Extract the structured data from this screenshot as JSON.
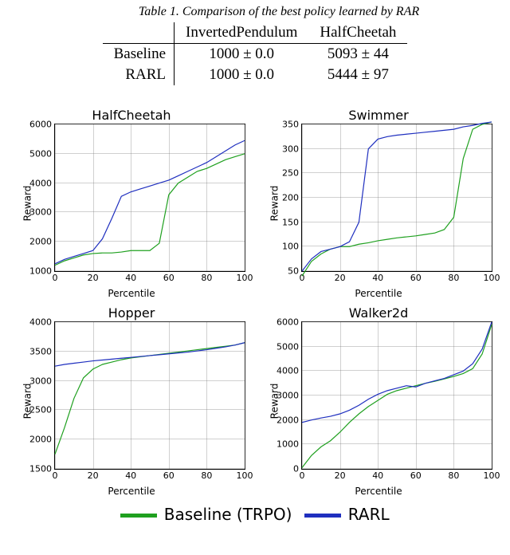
{
  "table": {
    "caption": "Table 1. Comparison of the best policy learned by RAR",
    "columns": [
      "InvertedPendulum",
      "HalfCheetah"
    ],
    "rows": [
      {
        "label": "Baseline",
        "values": [
          "1000 ± 0.0",
          "5093 ± 44"
        ]
      },
      {
        "label": "RARL",
        "values": [
          "1000 ± 0.0",
          "5444 ± 97"
        ]
      }
    ]
  },
  "chart_data": [
    {
      "type": "line",
      "title": "HalfCheetah",
      "xlabel": "Percentile",
      "ylabel": "Reward",
      "xlim": [
        0,
        100
      ],
      "ylim": [
        1000,
        6000
      ],
      "xticks": [
        0,
        20,
        40,
        60,
        80,
        100
      ],
      "yticks": [
        1000,
        2000,
        3000,
        4000,
        5000,
        6000
      ],
      "x": [
        0,
        5,
        10,
        15,
        20,
        25,
        30,
        35,
        40,
        45,
        50,
        55,
        60,
        65,
        70,
        75,
        80,
        85,
        90,
        95,
        100
      ],
      "series": [
        {
          "name": "Baseline (TRPO)",
          "color": "#1fa01f",
          "values": [
            1200,
            1350,
            1450,
            1550,
            1600,
            1620,
            1620,
            1650,
            1700,
            1700,
            1700,
            1950,
            3600,
            4000,
            4200,
            4400,
            4500,
            4650,
            4800,
            4900,
            5000
          ]
        },
        {
          "name": "RARL",
          "color": "#1f2fbf",
          "values": [
            1250,
            1400,
            1500,
            1600,
            1700,
            2100,
            2800,
            3550,
            3700,
            3800,
            3900,
            4000,
            4100,
            4250,
            4400,
            4550,
            4700,
            4900,
            5100,
            5300,
            5450
          ]
        }
      ]
    },
    {
      "type": "line",
      "title": "Swimmer",
      "xlabel": "Percentile",
      "ylabel": "Reward",
      "xlim": [
        0,
        100
      ],
      "ylim": [
        50,
        350
      ],
      "xticks": [
        0,
        20,
        40,
        60,
        80,
        100
      ],
      "yticks": [
        50,
        100,
        150,
        200,
        250,
        300,
        350
      ],
      "x": [
        0,
        5,
        10,
        15,
        20,
        25,
        30,
        35,
        40,
        45,
        50,
        55,
        60,
        65,
        70,
        75,
        80,
        85,
        90,
        95,
        100
      ],
      "series": [
        {
          "name": "Baseline (TRPO)",
          "color": "#1fa01f",
          "values": [
            40,
            70,
            85,
            95,
            100,
            100,
            105,
            108,
            112,
            115,
            118,
            120,
            122,
            125,
            128,
            135,
            160,
            280,
            340,
            350,
            355
          ]
        },
        {
          "name": "RARL",
          "color": "#1f2fbf",
          "values": [
            50,
            75,
            90,
            95,
            100,
            110,
            150,
            300,
            320,
            325,
            328,
            330,
            332,
            334,
            336,
            338,
            340,
            345,
            348,
            352,
            355
          ]
        }
      ]
    },
    {
      "type": "line",
      "title": "Hopper",
      "xlabel": "Percentile",
      "ylabel": "Reward",
      "xlim": [
        0,
        100
      ],
      "ylim": [
        1500,
        4000
      ],
      "xticks": [
        0,
        20,
        40,
        60,
        80,
        100
      ],
      "yticks": [
        1500,
        2000,
        2500,
        3000,
        3500,
        4000
      ],
      "x": [
        0,
        5,
        10,
        15,
        20,
        25,
        30,
        35,
        40,
        45,
        50,
        55,
        60,
        65,
        70,
        75,
        80,
        85,
        90,
        95,
        100
      ],
      "series": [
        {
          "name": "Baseline (TRPO)",
          "color": "#1fa01f",
          "values": [
            1750,
            2200,
            2700,
            3050,
            3200,
            3280,
            3320,
            3360,
            3390,
            3410,
            3430,
            3450,
            3470,
            3490,
            3510,
            3530,
            3550,
            3570,
            3590,
            3610,
            3650
          ]
        },
        {
          "name": "RARL",
          "color": "#1f2fbf",
          "values": [
            3250,
            3280,
            3300,
            3320,
            3340,
            3355,
            3370,
            3385,
            3400,
            3415,
            3430,
            3445,
            3460,
            3475,
            3490,
            3510,
            3530,
            3555,
            3580,
            3610,
            3650
          ]
        }
      ]
    },
    {
      "type": "line",
      "title": "Walker2d",
      "xlabel": "Percentile",
      "ylabel": "Reward",
      "xlim": [
        0,
        100
      ],
      "ylim": [
        0,
        6000
      ],
      "xticks": [
        0,
        20,
        40,
        60,
        80,
        100
      ],
      "yticks": [
        0,
        1000,
        2000,
        3000,
        4000,
        5000,
        6000
      ],
      "x": [
        0,
        5,
        10,
        15,
        20,
        25,
        30,
        35,
        40,
        45,
        50,
        55,
        60,
        65,
        70,
        75,
        80,
        85,
        90,
        95,
        100
      ],
      "series": [
        {
          "name": "Baseline (TRPO)",
          "color": "#1fa01f",
          "values": [
            50,
            550,
            900,
            1150,
            1500,
            1900,
            2250,
            2550,
            2800,
            3050,
            3200,
            3300,
            3400,
            3500,
            3580,
            3680,
            3780,
            3900,
            4100,
            4700,
            5900
          ]
        },
        {
          "name": "RARL",
          "color": "#1f2fbf",
          "values": [
            1900,
            2000,
            2080,
            2150,
            2250,
            2400,
            2600,
            2850,
            3050,
            3200,
            3300,
            3400,
            3350,
            3500,
            3600,
            3700,
            3850,
            4000,
            4300,
            4900,
            6000
          ]
        }
      ]
    }
  ],
  "legend": {
    "items": [
      {
        "label": "Baseline (TRPO)",
        "color": "#1fa01f"
      },
      {
        "label": "RARL",
        "color": "#1f2fbf"
      }
    ]
  }
}
